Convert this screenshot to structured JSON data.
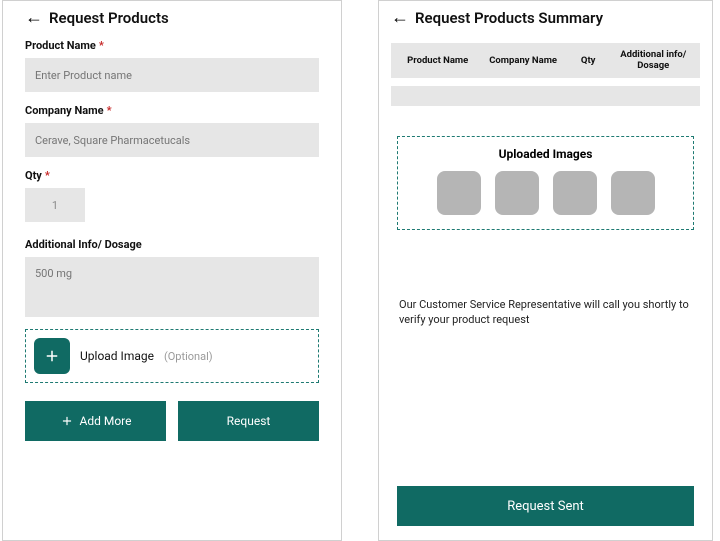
{
  "left": {
    "title": "Request Products",
    "product_name_label": "Product Name",
    "product_name_placeholder": "Enter Product name",
    "company_label": "Company Name",
    "company_placeholder": "Cerave, Square Pharmacetucals",
    "qty_label": "Qty",
    "qty_value": "1",
    "additional_label": "Additional Info/ Dosage",
    "additional_placeholder": "500 mg",
    "upload_label": "Upload Image",
    "upload_optional": "(Optional)",
    "add_more": "Add More",
    "request": "Request"
  },
  "right": {
    "title": "Request Products Summary",
    "table": {
      "h1": "Product  Name",
      "h2": "Company Name",
      "h3": "Qty",
      "h4": "Additional info/ Dosage"
    },
    "uploaded_title": "Uploaded Images",
    "notice": "Our Customer Service Representative will call you shortly to verify your product request",
    "sent": "Request Sent"
  }
}
